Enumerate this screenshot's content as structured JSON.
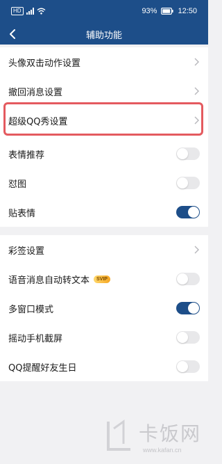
{
  "status_bar": {
    "hd": "HD",
    "battery": "93%",
    "time": "12:50"
  },
  "header": {
    "title": "辅助功能"
  },
  "group1": {
    "items": [
      {
        "label": "头像双击动作设置",
        "type": "nav"
      },
      {
        "label": "撤回消息设置",
        "type": "nav"
      },
      {
        "label": "超级QQ秀设置",
        "type": "nav",
        "highlighted": true
      },
      {
        "label": "表情推荐",
        "type": "toggle",
        "on": false
      },
      {
        "label": "怼图",
        "type": "toggle",
        "on": false
      },
      {
        "label": "贴表情",
        "type": "toggle",
        "on": true
      }
    ]
  },
  "group2": {
    "items": [
      {
        "label": "彩签设置",
        "type": "nav"
      },
      {
        "label": "语音消息自动转文本",
        "type": "toggle",
        "on": false,
        "badge": "SVIP"
      },
      {
        "label": "多窗口模式",
        "type": "toggle",
        "on": true
      },
      {
        "label": "摇动手机截屏",
        "type": "toggle",
        "on": false
      },
      {
        "label": "QQ提醒好友生日",
        "type": "toggle",
        "on": false
      }
    ]
  },
  "watermark": {
    "title": "卡饭网",
    "url": "www.kafan.cn"
  },
  "colors": {
    "primary": "#1d4e89",
    "highlight": "#e45a5f",
    "background": "#f1f1f3"
  },
  "icons": [
    "back-arrow-icon",
    "chevron-right-icon",
    "wifi-icon",
    "signal-icon",
    "battery-icon"
  ]
}
